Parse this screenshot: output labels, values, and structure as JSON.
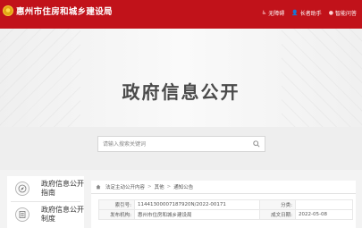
{
  "header": {
    "site_title": "惠州市住房和城乡建设局",
    "links": [
      {
        "icon": "accessibility-icon",
        "label": "无障碍"
      },
      {
        "icon": "elder-mode-icon",
        "label": "长者助手"
      },
      {
        "icon": "lightbulb-icon",
        "label": "智能问答"
      }
    ]
  },
  "hero": {
    "title": "政府信息公开"
  },
  "search": {
    "placeholder": "请输入搜索关键词"
  },
  "sidebar": {
    "items": [
      {
        "icon": "compass-icon",
        "label": "政府信息公开指南"
      },
      {
        "icon": "document-list-icon",
        "label": "政府信息公开制度"
      }
    ]
  },
  "breadcrumb": {
    "items": [
      "法定主动公开内容",
      "其他",
      "通知公告"
    ]
  },
  "meta": {
    "index_label": "索引号:",
    "index_value": "11441300007187920N/2022-00171",
    "category_label": "分类:",
    "category_value": "",
    "publisher_label": "发布机构:",
    "publisher_value": "惠州市住房和城乡建设局",
    "date_label": "成文日期:",
    "date_value": "2022-05-08"
  },
  "colors": {
    "brand_red": "#c1121a",
    "hero_bg": "#f4f4f4",
    "band_bg": "#eeeeee"
  }
}
